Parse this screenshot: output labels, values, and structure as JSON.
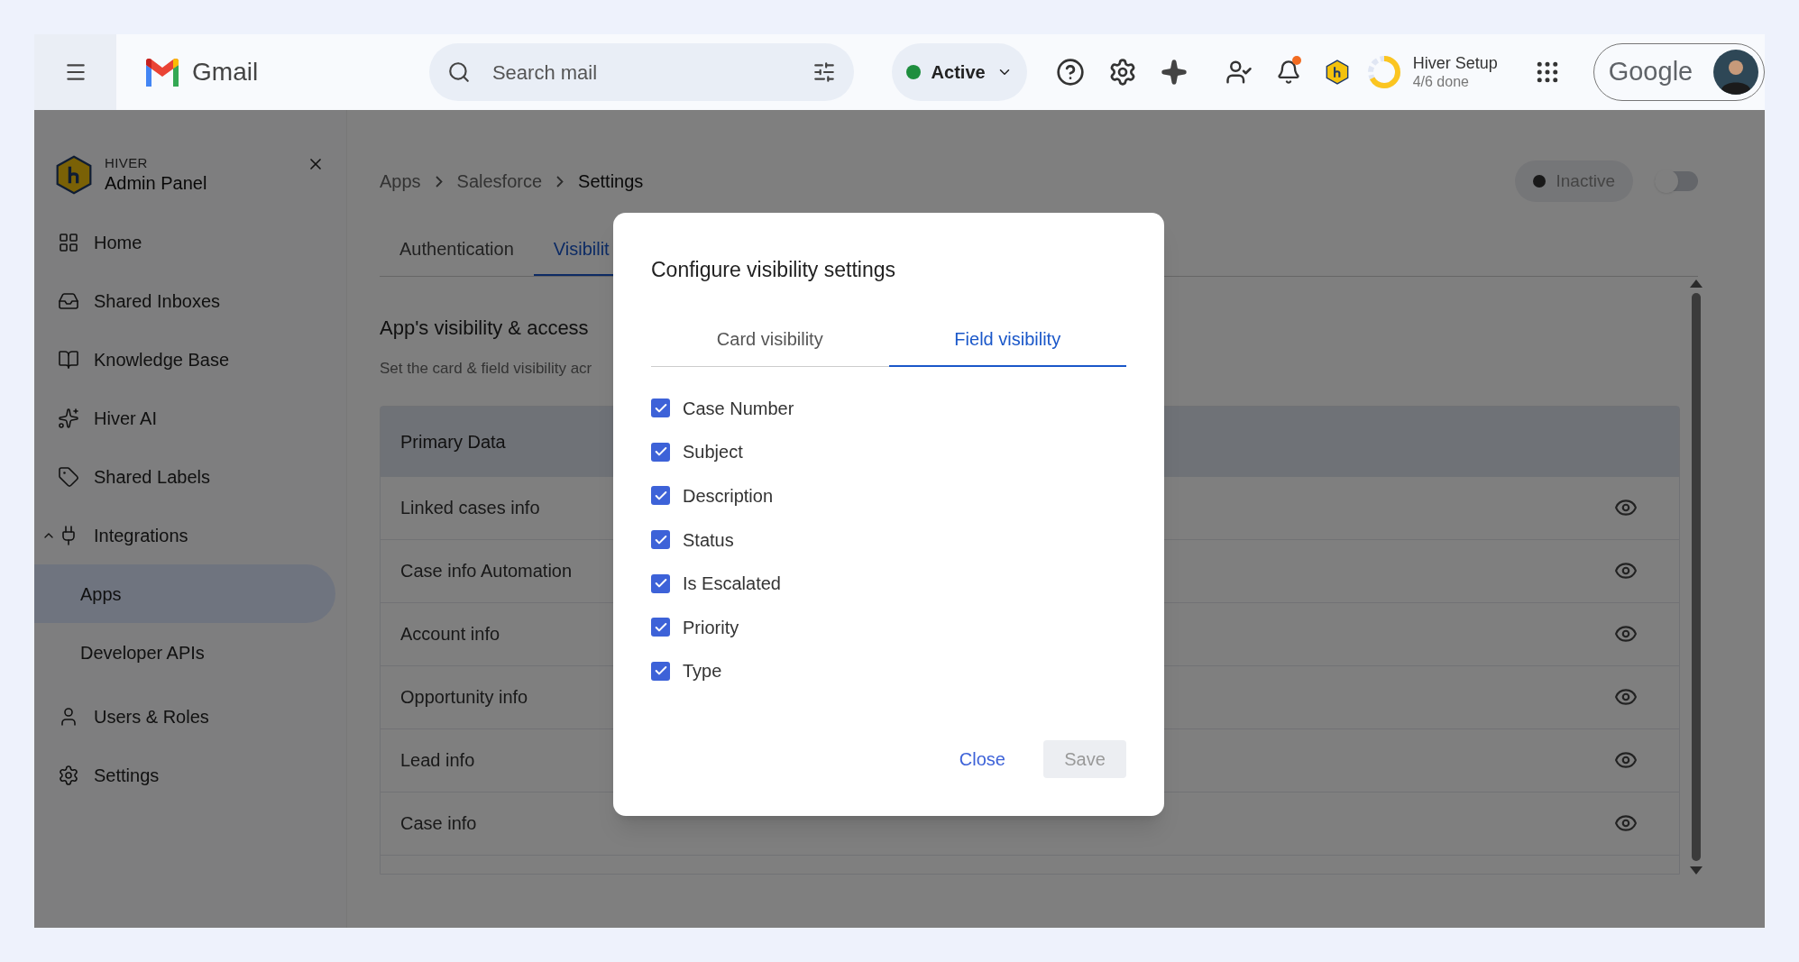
{
  "top_bar": {
    "app_name": "Gmail",
    "search": {
      "placeholder": "Search mail"
    },
    "status": {
      "label": "Active"
    },
    "notification_dot": true,
    "setup": {
      "title": "Hiver Setup",
      "progress": "4/6 done"
    },
    "account": {
      "label": "Google"
    }
  },
  "sidebar": {
    "brand": {
      "kicker": "HIVER",
      "title": "Admin Panel"
    },
    "items": [
      {
        "label": "Home",
        "selected": false
      },
      {
        "label": "Shared Inboxes",
        "selected": false
      },
      {
        "label": "Knowledge Base",
        "selected": false
      },
      {
        "label": "Hiver AI",
        "selected": false
      },
      {
        "label": "Shared Labels",
        "selected": false
      },
      {
        "label": "Integrations",
        "selected": false,
        "expanded": true,
        "children": [
          {
            "label": "Apps",
            "selected": true
          },
          {
            "label": "Developer APIs",
            "selected": false
          }
        ]
      },
      {
        "label": "Users & Roles",
        "selected": false
      },
      {
        "label": "Settings",
        "selected": false
      }
    ]
  },
  "main": {
    "breadcrumb": [
      "Apps",
      "Salesforce",
      "Settings"
    ],
    "status": {
      "label": "Inactive"
    },
    "toggle": {
      "on": false
    },
    "tabs": [
      {
        "label": "Authentication",
        "selected": false
      },
      {
        "label": "Visibilit",
        "selected": true
      }
    ],
    "section": {
      "title": "App's visibility & access",
      "subtitle": "Set the card & field visibility acr"
    },
    "table": {
      "header": "Primary Data",
      "rows": [
        "Linked cases info",
        "Case info Automation",
        "Account info",
        "Opportunity info",
        "Lead info",
        "Case info"
      ]
    }
  },
  "dialog": {
    "title": "Configure visibility settings",
    "tabs": [
      {
        "label": "Card visibility",
        "selected": false
      },
      {
        "label": "Field visibility",
        "selected": true
      }
    ],
    "fields": [
      {
        "label": "Case Number",
        "checked": true
      },
      {
        "label": "Subject",
        "checked": true
      },
      {
        "label": "Description",
        "checked": true
      },
      {
        "label": "Status",
        "checked": true
      },
      {
        "label": "Is Escalated",
        "checked": true
      },
      {
        "label": "Priority",
        "checked": true
      },
      {
        "label": "Type",
        "checked": true
      }
    ],
    "buttons": [
      {
        "label": "Close",
        "kind": "text",
        "disabled": false
      },
      {
        "label": "Save",
        "kind": "filled",
        "disabled": true
      }
    ]
  }
}
